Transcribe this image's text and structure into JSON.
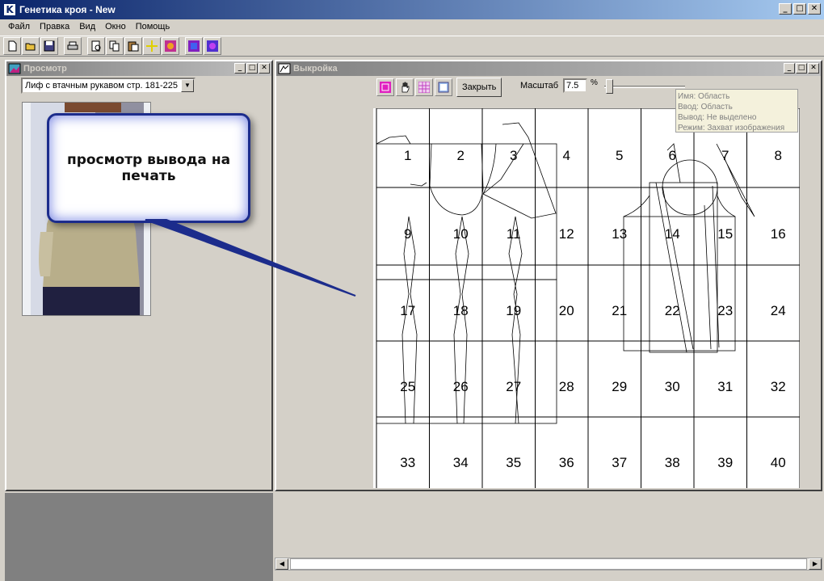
{
  "app": {
    "title": "Генетика кроя - New",
    "icon": "K"
  },
  "window_controls": {
    "minimize": "_",
    "maximize": "□",
    "close": "✕"
  },
  "menu": [
    "Файл",
    "Правка",
    "Вид",
    "Окно",
    "Помощь"
  ],
  "toolbar": [
    "new-icon",
    "open-icon",
    "save-icon",
    "print-icon",
    "preview-icon",
    "copy-icon",
    "paste-icon",
    "add-icon",
    "image-icon",
    "magic-icon",
    "palette-icon"
  ],
  "preview_window": {
    "title": "Просмотр",
    "selected_item": "Лиф с втачным рукавом стр. 181-225"
  },
  "callout": {
    "text": "просмотр вывода на печать"
  },
  "pattern_window": {
    "title": "Выкройка",
    "close_label": "Закрыть",
    "scale_label": "Масштаб",
    "scale_value": "7.5",
    "scale_unit": "%",
    "tooltip": [
      "Имя: Область",
      "Ввод: Область",
      "Вывод: Не выделено",
      "Режим: Захват изображения"
    ]
  },
  "pages": [
    "1",
    "2",
    "3",
    "4",
    "5",
    "6",
    "7",
    "8",
    "9",
    "10",
    "11",
    "12",
    "13",
    "14",
    "15",
    "16",
    "17",
    "18",
    "19",
    "20",
    "21",
    "22",
    "23",
    "24",
    "25",
    "26",
    "27",
    "28",
    "29",
    "30",
    "31",
    "32",
    "33",
    "34",
    "35",
    "36",
    "37",
    "38",
    "39",
    "40"
  ],
  "colors": {
    "title_active": "#0a246a",
    "callout_border": "#1c2c8c",
    "pointer": "#1c2c8c"
  }
}
